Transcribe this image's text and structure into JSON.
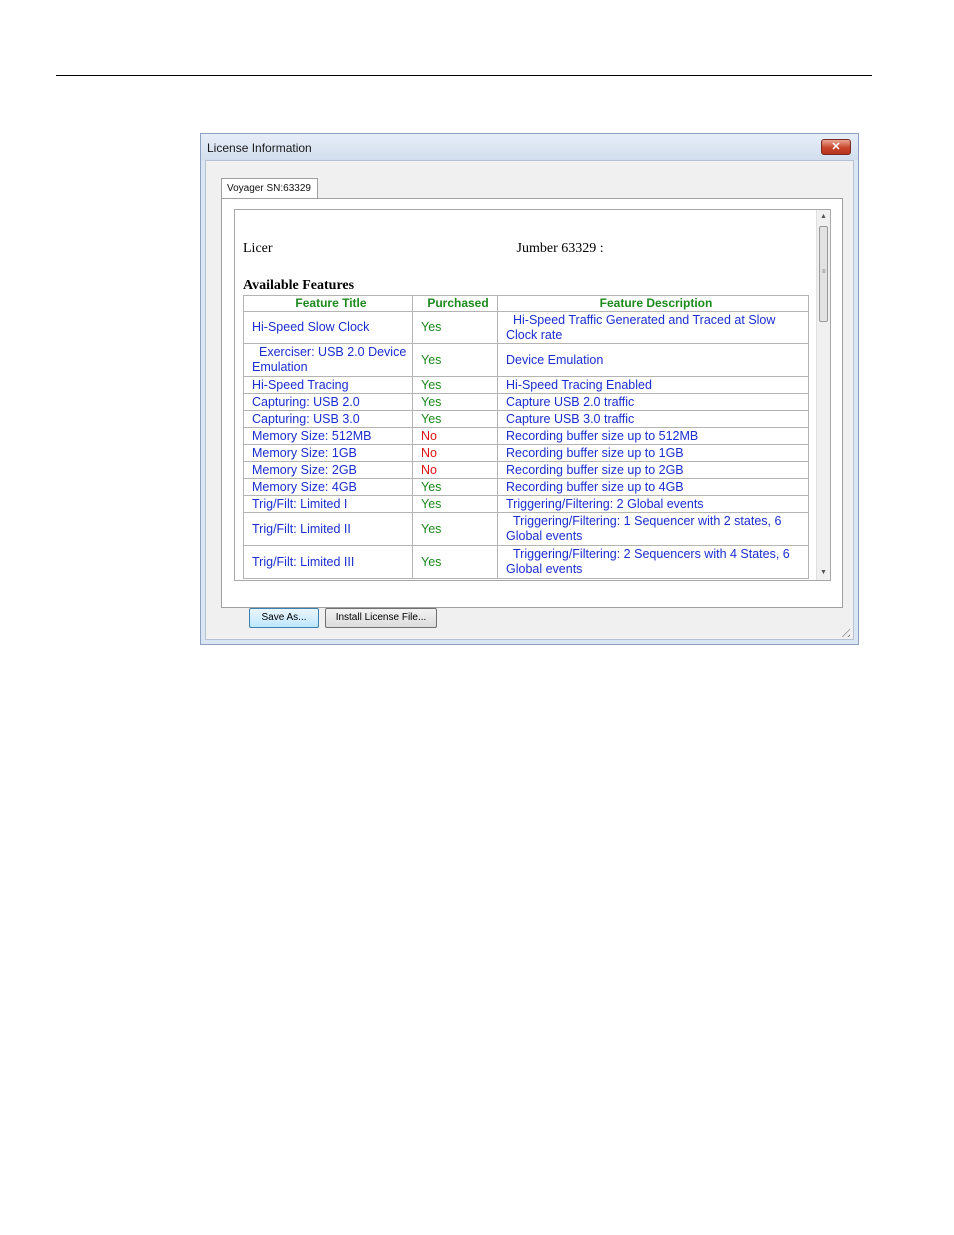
{
  "window": {
    "title": "License Information",
    "close_glyph": "✕"
  },
  "tab": {
    "label": "Voyager SN:63329"
  },
  "report": {
    "license_prefix": "Licer",
    "license_suffix": "Jumber 63329 :",
    "features_heading": "Available Features"
  },
  "table": {
    "headers": [
      "Feature Title",
      "Purchased",
      "Feature Description"
    ],
    "rows": [
      {
        "title": "Hi-Speed Slow Clock",
        "purchased": "Yes",
        "description": "Hi-Speed Traffic Generated and Traced at Slow Clock rate"
      },
      {
        "title": "Exerciser: USB 2.0 Device Emulation",
        "purchased": "Yes",
        "description": "Device Emulation"
      },
      {
        "title": "Hi-Speed Tracing",
        "purchased": "Yes",
        "description": "Hi-Speed Tracing Enabled"
      },
      {
        "title": "Capturing: USB 2.0",
        "purchased": "Yes",
        "description": "Capture USB 2.0 traffic"
      },
      {
        "title": "Capturing: USB 3.0",
        "purchased": "Yes",
        "description": "Capture USB 3.0 traffic"
      },
      {
        "title": "Memory Size: 512MB",
        "purchased": "No",
        "description": "Recording buffer size up to 512MB"
      },
      {
        "title": "Memory Size: 1GB",
        "purchased": "No",
        "description": "Recording buffer size up to 1GB"
      },
      {
        "title": "Memory Size: 2GB",
        "purchased": "No",
        "description": "Recording buffer size up to 2GB"
      },
      {
        "title": "Memory Size: 4GB",
        "purchased": "Yes",
        "description": "Recording buffer size up to 4GB"
      },
      {
        "title": "Trig/Filt: Limited I",
        "purchased": "Yes",
        "description": "Triggering/Filtering: 2 Global events"
      },
      {
        "title": "Trig/Filt: Limited II",
        "purchased": "Yes",
        "description": "Triggering/Filtering: 1 Sequencer with 2 states, 6 Global events"
      },
      {
        "title": "Trig/Filt: Limited III",
        "purchased": "Yes",
        "description": "Triggering/Filtering: 2 Sequencers with 4 States, 6 Global events"
      }
    ]
  },
  "buttons": {
    "save_as": "Save As...",
    "install_license": "Install License File..."
  },
  "colors": {
    "header_green": "#1c8a1c",
    "link_blue": "#1a2ecf",
    "no_red": "#e01010"
  },
  "icons": [
    "close-icon",
    "scroll-up-icon",
    "scroll-down-icon",
    "resize-grip-icon"
  ]
}
